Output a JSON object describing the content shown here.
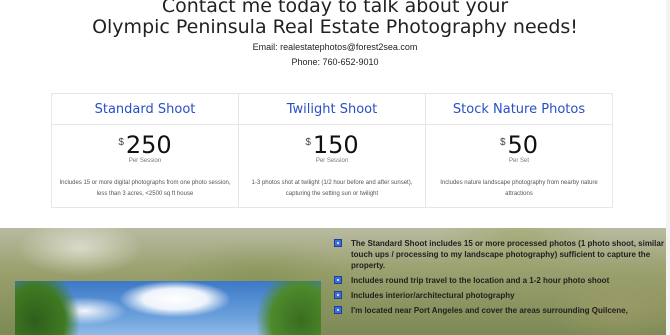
{
  "header": {
    "line1": "Contact me today to talk about your",
    "line2": "Olympic Peninsula Real Estate Photography needs!",
    "email": "Email: realestatephotos@forest2sea.com",
    "phone": "Phone: 760-652-9010"
  },
  "pricing": [
    {
      "title": "Standard Shoot",
      "currency": "$",
      "amount": "250",
      "period": "Per Session",
      "description": "Includes 15 or more digital photographs from one photo session, less than 3 acres, <2500 sq ft house"
    },
    {
      "title": "Twilight Shoot",
      "currency": "$",
      "amount": "150",
      "period": "Per Session",
      "description": "1-3 photos shot at twilight (1/2 hour before and after sunset), capturing the setting sun or twilight"
    },
    {
      "title": "Stock Nature Photos",
      "currency": "$",
      "amount": "50",
      "period": "Per Set",
      "description": "Includes nature landscape photography from nearby nature attractions"
    }
  ],
  "bullets": [
    "The Standard Shoot includes 15 or more processed photos (1 photo shoot, similar touch ups / processing to my landscape photography) sufficient to capture the property.",
    "Includes round trip travel to the location and a 1-2 hour photo shoot",
    "Includes interior/architectural photography",
    "I'm located near Port Angeles and cover the areas surrounding Quilcene,"
  ],
  "colors": {
    "title_blue": "#2a4fc4",
    "bullet_icon": "#3f6fd6"
  }
}
